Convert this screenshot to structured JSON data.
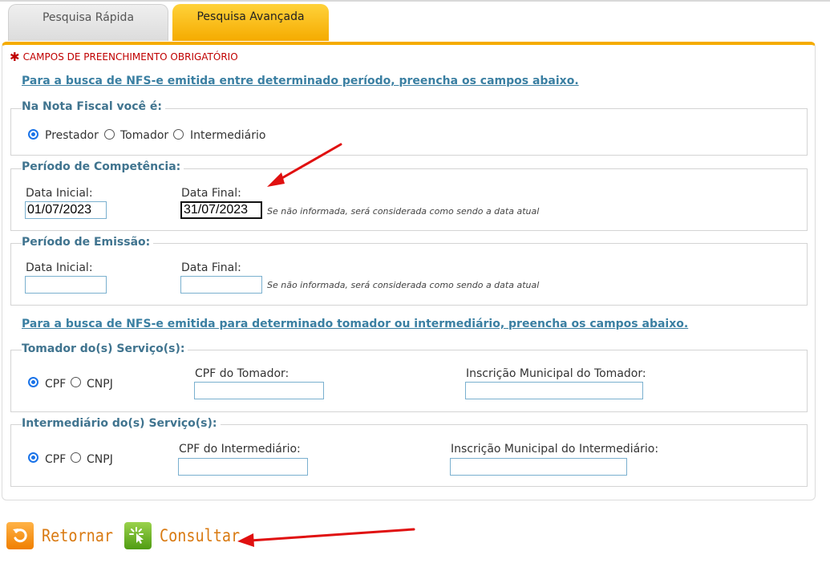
{
  "tabs": [
    {
      "label": "Pesquisa Rápida",
      "active": false
    },
    {
      "label": "Pesquisa Avançada",
      "active": true
    }
  ],
  "required_note": "CAMPOS DE PREENCHIMENTO OBRIGATÓRIO",
  "instructions": {
    "period": "Para a busca de NFS-e emitida entre determinado período, preencha os campos abaixo.",
    "party": "Para a busca de NFS-e emitida para determinado tomador ou intermediário, preencha os campos abaixo."
  },
  "role": {
    "legend": "Na Nota Fiscal você é:",
    "options": [
      "Prestador",
      "Tomador",
      "Intermediário"
    ],
    "selected": "Prestador"
  },
  "competencia": {
    "legend": "Período de Competência:",
    "start_label": "Data Inicial:",
    "start_value": "01/07/2023",
    "end_label": "Data Final:",
    "end_value": "31/07/2023",
    "hint": "Se não informada, será considerada como sendo a data atual"
  },
  "emissao": {
    "legend": "Período de Emissão:",
    "start_label": "Data Inicial:",
    "start_value": "",
    "end_label": "Data Final:",
    "end_value": "",
    "hint": "Se não informada, será considerada como sendo a data atual"
  },
  "tomador": {
    "legend": "Tomador do(s) Serviço(s):",
    "doc_options": [
      "CPF",
      "CNPJ"
    ],
    "doc_selected": "CPF",
    "doc_label": "CPF do Tomador:",
    "doc_value": "",
    "im_label": "Inscrição Municipal do Tomador:",
    "im_value": ""
  },
  "intermediario": {
    "legend": "Intermediário do(s) Serviço(s):",
    "doc_options": [
      "CPF",
      "CNPJ"
    ],
    "doc_selected": "CPF",
    "doc_label": "CPF do Intermediário:",
    "doc_value": "",
    "im_label": "Inscrição Municipal do Intermediário:",
    "im_value": ""
  },
  "buttons": {
    "back": "Retornar",
    "search": "Consultar"
  },
  "colors": {
    "accent": "#f5ab00",
    "link": "#3a7fa2",
    "legend": "#40748f",
    "required": "#c00000",
    "button_text": "#d97a12",
    "annotation_arrow": "#e01010"
  },
  "icons": {
    "required": "asterisk-icon",
    "back": "return-arrow-icon",
    "search": "cursor-click-icon"
  }
}
